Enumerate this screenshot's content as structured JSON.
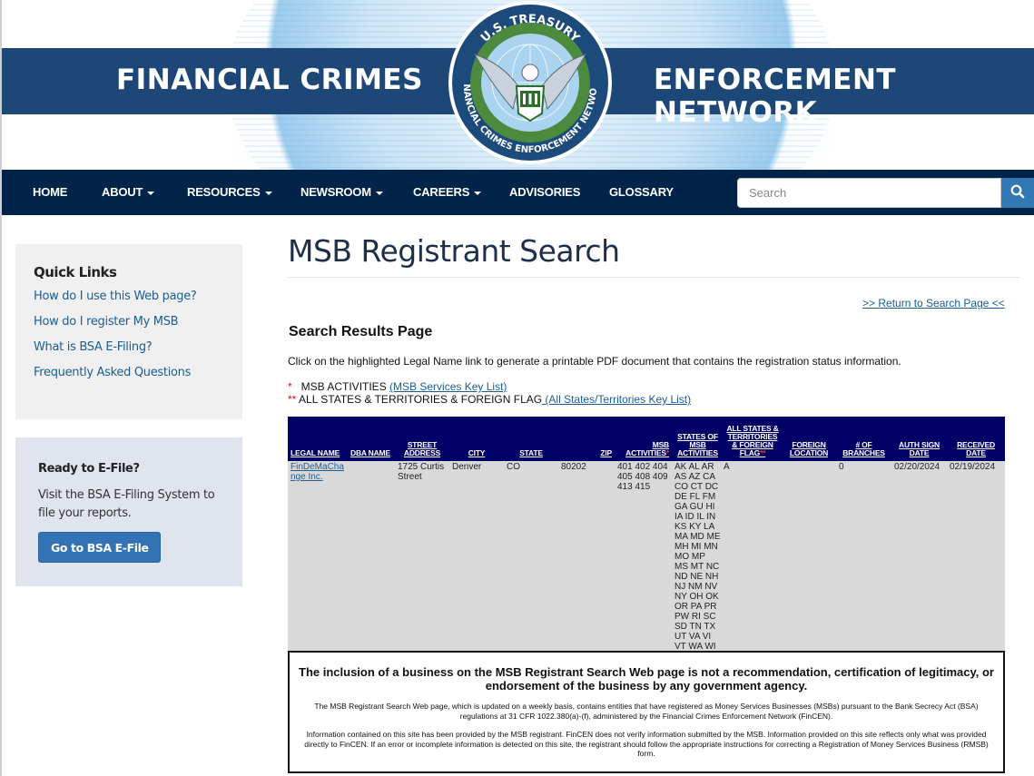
{
  "banner": {
    "left_text": "FINANCIAL CRIMES",
    "right_text": "ENFORCEMENT NETWORK",
    "seal_top_text": "U.S. TREASURY",
    "seal_bottom_text": "FINANCIAL CRIMES ENFORCEMENT NETWORK"
  },
  "nav": {
    "items": [
      {
        "label": "HOME",
        "dropdown": false
      },
      {
        "label": "ABOUT",
        "dropdown": true
      },
      {
        "label": "RESOURCES",
        "dropdown": true
      },
      {
        "label": "NEWSROOM",
        "dropdown": true
      },
      {
        "label": "CAREERS",
        "dropdown": true
      },
      {
        "label": "ADVISORIES",
        "dropdown": false
      },
      {
        "label": "GLOSSARY",
        "dropdown": false
      }
    ],
    "search_placeholder": "Search",
    "search_value": "",
    "search_icon": "magnifier-icon"
  },
  "sidebar": {
    "quick_links_title": "Quick Links",
    "quick_links": [
      "How do I use this Web page?",
      "How do I register My MSB",
      "What is BSA E-Filing?",
      "Frequently Asked Questions"
    ],
    "efile_title": "Ready to E-File?",
    "efile_text": "Visit the BSA E-Filing System to file your reports.",
    "efile_button": "Go to BSA E-File"
  },
  "main": {
    "title": "MSB Registrant Search",
    "return_link": ">> Return to Search Page <<",
    "results_title": "Search Results Page",
    "instructions": "Click on the highlighted Legal Name link to generate a printable PDF document that contains the registration status information.",
    "key1_marker": "*",
    "key1_label": "   MSB ACTIVITIES ",
    "key1_link": "(MSB Services Key List)",
    "key2_marker": "**",
    "key2_label": " ALL STATES & TERRITORIES & FOREIGN FLAG",
    "key2_link": " (All States/Territories Key List)"
  },
  "table": {
    "headers": {
      "legal_name": "LEGAL NAME",
      "dba_name": "DBA NAME",
      "street_address": "STREET ADDRESS",
      "city": "CITY",
      "state": "STATE",
      "zip": "ZIP",
      "msb_activities": "MSB ACTIVITIES",
      "msb_activities_marker": "*",
      "states_of_msb_activities": "STATES OF MSB ACTIVITIES",
      "all_states_flag": "ALL STATES & TERRITORIES & FOREIGN FLAG",
      "all_states_flag_marker": "**",
      "foreign_location": "FOREIGN LOCATION",
      "num_branches": "# OF BRANCHES",
      "auth_sign_date": "AUTH SIGN DATE",
      "received_date": "RECEIVED DATE"
    },
    "rows": [
      {
        "legal_name": "FinDeMaChange Inc.",
        "dba_name": "",
        "street_address": "1725 Curtis Street",
        "city": "Denver",
        "state": "CO",
        "zip": "80202",
        "msb_activities": "401 402 404 405 408 409 413 415",
        "states_of_msb_activities": "AK AL AR AS AZ CA CO CT DC DE FL FM GA GU HI IA ID IL IN KS KY LA MA MD ME MH MI MN MO MP MS MT NC ND NE NH NJ NM NV NY OH OK OR PA PR PW RI SC SD TN TX UT VA VI VT WA WI WV WY",
        "all_states_flag": "A",
        "foreign_location": "",
        "num_branches": "0",
        "auth_sign_date": "02/20/2024",
        "received_date": "02/19/2024"
      }
    ]
  },
  "disclaimer": {
    "heading": "The inclusion of a business on the MSB Registrant Search Web page is not a recommendation, certification of legitimacy, or endorsement of the business by any government agency.",
    "paragraph1": "The MSB Registrant Search Web page, which is updated on a weekly basis, contains entities that have registered as Money Services Businesses (MSBs) pursuant to the Bank Secrecy Act (BSA) regulations at 31 CFR 1022.380(a)-(f), administered by the Financial Crimes Enforcement Network (FinCEN).",
    "paragraph2": "Information contained on this site has been provided by the MSB registrant. FinCEN does not verify information submitted by the MSB. Information provided on this site reflects only what was provided directly to FinCEN. If an error or incomplete information is detected on this site, the registrant should follow the appropriate instructions for correcting a Registration of Money Services Business (RMSB) form."
  },
  "colors": {
    "banner_band": "#1d4777",
    "navbar": "#002449",
    "search_button": "#3278b5",
    "link": "#1c5d94",
    "table_header": "#000066",
    "table_row": "#d9d9d9",
    "asterisk": "#dd1111"
  }
}
